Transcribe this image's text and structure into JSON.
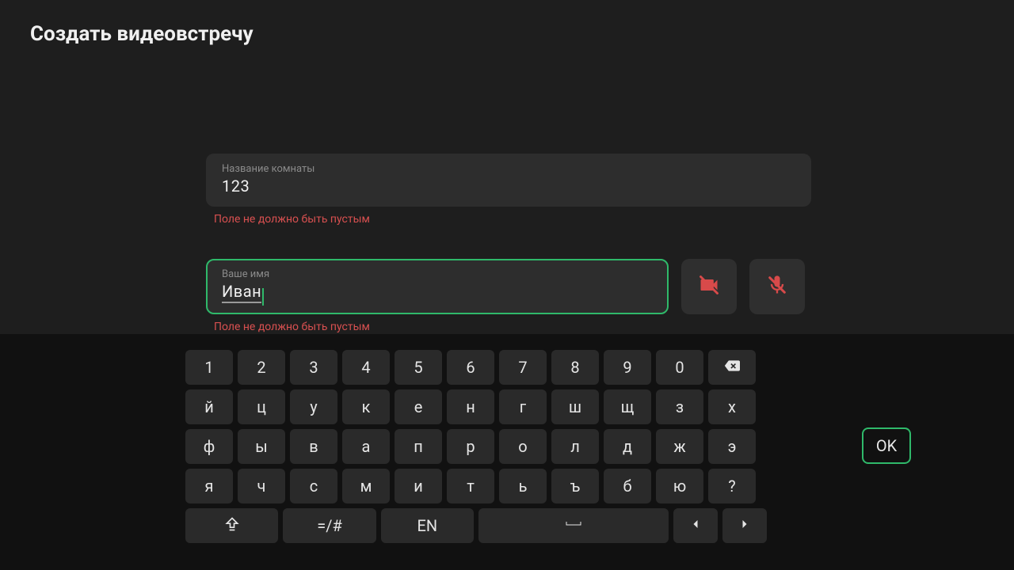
{
  "title": "Создать видеовстречу",
  "form": {
    "room": {
      "label": "Название комнаты",
      "value": "123",
      "error": "Поле не должно быть пустым"
    },
    "name": {
      "label": "Ваше имя",
      "value": "Иван",
      "error": "Поле не должно быть пустым"
    }
  },
  "keyboard": {
    "row1": [
      "1",
      "2",
      "3",
      "4",
      "5",
      "6",
      "7",
      "8",
      "9",
      "0"
    ],
    "row2": [
      "й",
      "ц",
      "у",
      "к",
      "е",
      "н",
      "г",
      "ш",
      "щ",
      "з",
      "х"
    ],
    "row3": [
      "ф",
      "ы",
      "в",
      "а",
      "п",
      "р",
      "о",
      "л",
      "д",
      "ж",
      "э"
    ],
    "row4": [
      "я",
      "ч",
      "с",
      "м",
      "и",
      "т",
      "ь",
      "ъ",
      "б",
      "ю",
      "?"
    ],
    "symRow": "=/#",
    "langRow": "EN",
    "ok": "OK"
  },
  "icons": {
    "camera": "camera-off-icon",
    "mic": "mic-off-icon",
    "backspace": "backspace-icon",
    "shift": "shift-icon",
    "space": "space-icon",
    "left": "arrow-left-icon",
    "right": "arrow-right-icon"
  },
  "colors": {
    "accent": "#2fb96a",
    "error": "#d85050",
    "iconDanger": "#d84a4a"
  }
}
